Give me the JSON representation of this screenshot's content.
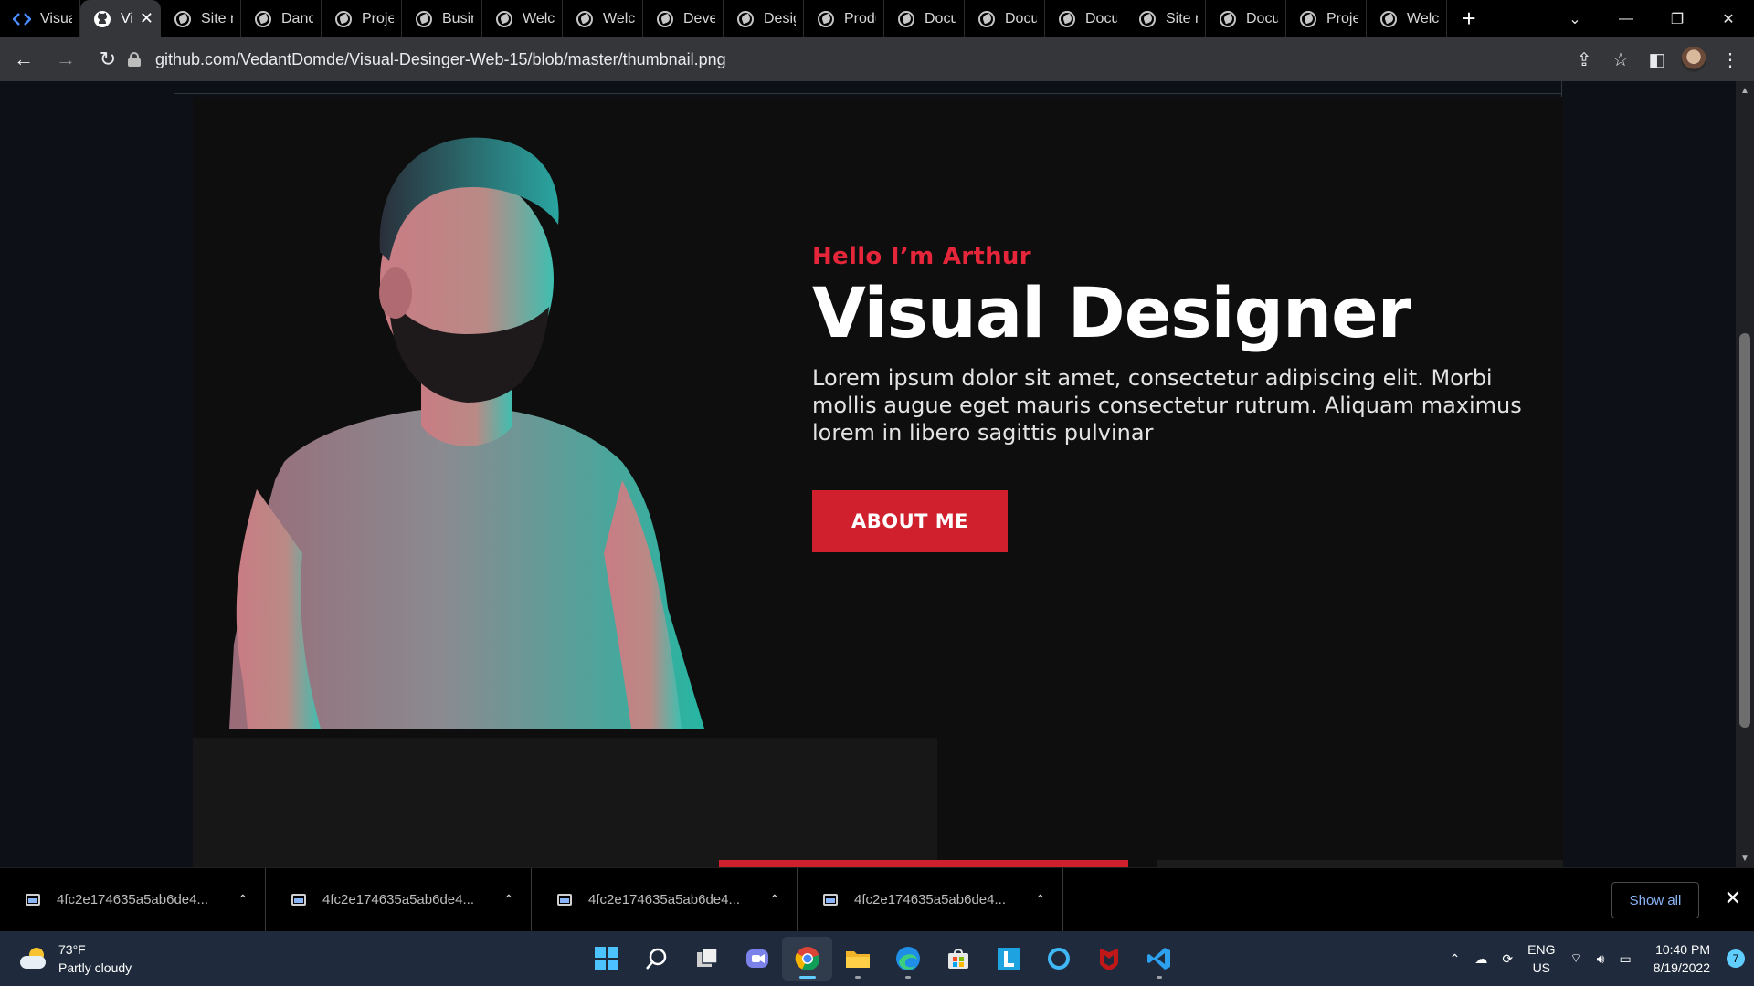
{
  "browser": {
    "tabs": [
      {
        "label": "Visual",
        "icon": "code-icon",
        "active": false
      },
      {
        "label": "Vi",
        "icon": "github-icon",
        "active": true
      },
      {
        "label": "Site n",
        "icon": "globe-icon",
        "active": false
      },
      {
        "label": "Danc",
        "icon": "globe-icon",
        "active": false
      },
      {
        "label": "Proje",
        "icon": "globe-icon",
        "active": false
      },
      {
        "label": "Busin",
        "icon": "globe-icon",
        "active": false
      },
      {
        "label": "Welc",
        "icon": "globe-icon",
        "active": false
      },
      {
        "label": "Welc",
        "icon": "globe-icon",
        "active": false
      },
      {
        "label": "Devel",
        "icon": "globe-icon",
        "active": false
      },
      {
        "label": "Desig",
        "icon": "globe-icon",
        "active": false
      },
      {
        "label": "Produ",
        "icon": "globe-icon",
        "active": false
      },
      {
        "label": "Docu",
        "icon": "globe-icon",
        "active": false
      },
      {
        "label": "Docu",
        "icon": "globe-icon",
        "active": false
      },
      {
        "label": "Docu",
        "icon": "globe-icon",
        "active": false
      },
      {
        "label": "Site n",
        "icon": "globe-icon",
        "active": false
      },
      {
        "label": "Docu",
        "icon": "globe-icon",
        "active": false
      },
      {
        "label": "Proje",
        "icon": "globe-icon",
        "active": false
      },
      {
        "label": "Welc",
        "icon": "globe-icon",
        "active": false
      }
    ],
    "url": "github.com/VedantDomde/Visual-Desinger-Web-15/blob/master/thumbnail.png"
  },
  "hero": {
    "greeting": "Hello I’m Arthur",
    "headline": "Visual Designer",
    "body": "Lorem ipsum dolor sit amet, consectetur adipiscing elit. Morbi mollis augue eget mauris consectetur rutrum. Aliquam maximus lorem in libero sagittis pulvinar",
    "button_label": "ABOUT ME",
    "accent_color": "#d0202d"
  },
  "downloads": {
    "items": [
      {
        "name": "4fc2e174635a5ab6de4..."
      },
      {
        "name": "4fc2e174635a5ab6de4..."
      },
      {
        "name": "4fc2e174635a5ab6de4..."
      },
      {
        "name": "4fc2e174635a5ab6de4..."
      }
    ],
    "show_all_label": "Show all"
  },
  "taskbar": {
    "weather_temp": "73°F",
    "weather_desc": "Partly cloudy",
    "lang_top": "ENG",
    "lang_bottom": "US",
    "time": "10:40 PM",
    "date": "8/19/2022",
    "notification_count": "7",
    "apps": [
      "start-icon",
      "search-icon",
      "task-view-icon",
      "teams-chat-icon",
      "chrome-icon",
      "file-explorer-icon",
      "edge-icon",
      "store-icon",
      "l-app-icon",
      "cortana-icon",
      "mcafee-icon",
      "vscode-icon"
    ]
  }
}
